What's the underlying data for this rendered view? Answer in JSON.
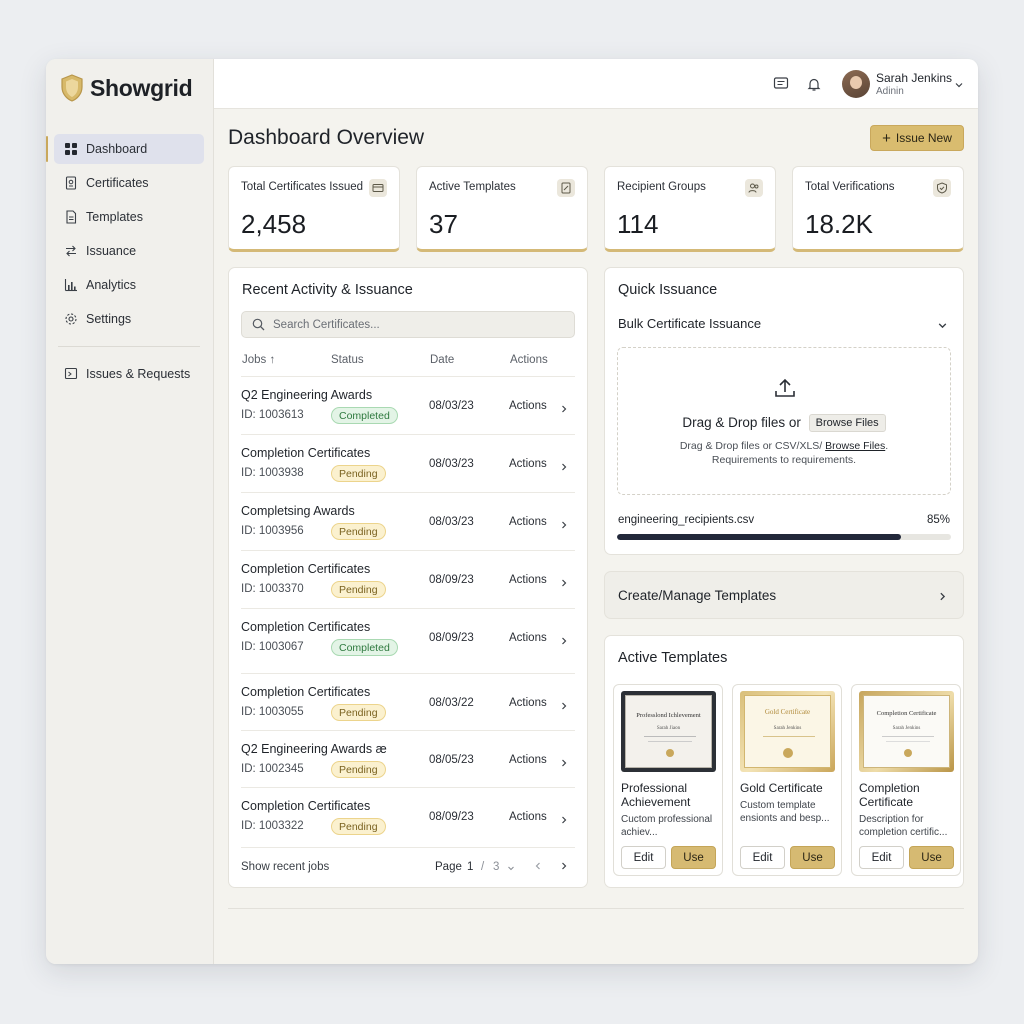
{
  "app": {
    "name": "Showgrid"
  },
  "colors": {
    "accent": "#d9bc6f",
    "completed": "#2f7a3f",
    "pending": "#7a6220",
    "progress": "#22283a"
  },
  "sidebar": {
    "items": [
      {
        "label": "Dashboard",
        "icon": "grid-icon",
        "active": true
      },
      {
        "label": "Certificates",
        "icon": "certificate-icon"
      },
      {
        "label": "Templates",
        "icon": "document-icon"
      },
      {
        "label": "Issuance",
        "icon": "arrows-swap-icon"
      },
      {
        "label": "Analytics",
        "icon": "bar-chart-icon"
      },
      {
        "label": "Settings",
        "icon": "gear-icon"
      }
    ],
    "secondary": [
      {
        "label": "Issues & Requests",
        "icon": "inbox-icon"
      }
    ]
  },
  "topbar": {
    "user_name": "Sarah Jenkins",
    "user_role": "Adinin"
  },
  "page": {
    "title": "Dashboard Overview",
    "issue_button": "Issue New"
  },
  "stats": [
    {
      "label": "Total Certificates Issued",
      "value": "2,458",
      "icon": "card-icon"
    },
    {
      "label": "Active Templates",
      "value": "37",
      "icon": "edit-doc-icon"
    },
    {
      "label": "Recipient Groups",
      "value": "114",
      "icon": "users-icon"
    },
    {
      "label": "Total Verifications",
      "value": "18.2K",
      "icon": "shield-check-icon"
    }
  ],
  "activity": {
    "title": "Recent Activity & Issuance",
    "search_placeholder": "Search Certificates...",
    "columns": {
      "jobs": "Jobs",
      "status": "Status",
      "date": "Date",
      "actions": "Actions"
    },
    "rows": [
      {
        "name": "Q2 Engineering Awards",
        "id": "ID: 1003613",
        "status": "Completed",
        "date": "08/03/23",
        "action": "Actions"
      },
      {
        "name": "Completion Certificates",
        "id": "ID: 1003938",
        "status": "Pending",
        "date": "08/03/23",
        "action": "Actions"
      },
      {
        "name": "Completsing Awards",
        "id": "ID: 1003956",
        "status": "Pending",
        "date": "08/03/23",
        "action": "Actions"
      },
      {
        "name": "Completion Certificates",
        "id": "ID: 1003370",
        "status": "Pending",
        "date": "08/09/23",
        "action": "Actions"
      },
      {
        "name": "Completion Certificates",
        "id": "ID: 1003067",
        "status": "Completed",
        "date": "08/09/23",
        "action": "Actions"
      },
      {
        "name": "Completion Certificates",
        "id": "ID: 1003055",
        "status": "Pending",
        "date": "08/03/22",
        "action": "Actions"
      },
      {
        "name": "Q2 Engineering Awards æ",
        "id": "ID: 1002345",
        "status": "Pending",
        "date": "08/05/23",
        "action": "Actions"
      },
      {
        "name": "Completion Certificates",
        "id": "ID: 1003322",
        "status": "Pending",
        "date": "08/09/23",
        "action": "Actions"
      }
    ],
    "footer": {
      "label": "Show recent jobs",
      "page_label": "Page",
      "page": "1",
      "sep": "/",
      "total": "3"
    }
  },
  "quick": {
    "title": "Quick Issuance",
    "dropdown": "Bulk Certificate Issuance",
    "drop_main": "Drag & Drop files or",
    "browse_button": "Browse Files",
    "drop_sub1": "Drag & Drop files or CSV/XLS/",
    "drop_sub1_link": "Browse Files",
    "drop_sub1_end": ".",
    "drop_sub2": "Requirements to requirements.",
    "file_name": "engineering_recipients.csv",
    "progress_label": "85%",
    "progress": 0.85
  },
  "manage": {
    "label": "Create/Manage Templates"
  },
  "templates": {
    "title": "Active Templates",
    "items": [
      {
        "name": "Professional Achievement",
        "desc": "Cuctom professional achiev...",
        "thumb_title": "Professlond Ichlevement",
        "thumb_name": "Sarah Jiaon",
        "edit": "Edit",
        "use": "Use"
      },
      {
        "name": "Gold Certificate",
        "desc": "Custom template ensionts and besp...",
        "thumb_title": "Gold Certificate",
        "thumb_name": "Sarah Jenkins",
        "edit": "Edit",
        "use": "Use"
      },
      {
        "name": "Completion Certificate",
        "desc": "Description for completion certific...",
        "thumb_title": "Completion Certificate",
        "thumb_name": "Sarah Jenkins",
        "edit": "Edit",
        "use": "Use"
      }
    ]
  }
}
